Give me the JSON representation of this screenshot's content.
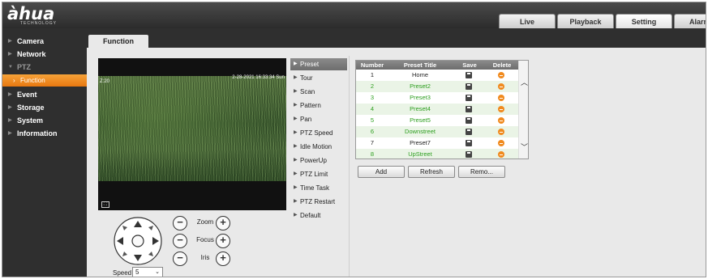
{
  "header": {
    "logo_text": "àhua",
    "logo_sub": "TECHNOLOGY",
    "tabs": [
      {
        "label": "Live"
      },
      {
        "label": "Playback"
      },
      {
        "label": "Setting"
      },
      {
        "label": "Alarm"
      }
    ],
    "active_tab": "Setting"
  },
  "sidebar": {
    "items": [
      {
        "label": "Camera"
      },
      {
        "label": "Network"
      },
      {
        "label": "PTZ"
      },
      {
        "label": "Event"
      },
      {
        "label": "Storage"
      },
      {
        "label": "System"
      },
      {
        "label": "Information"
      }
    ],
    "sub_item": {
      "label": "Function"
    }
  },
  "content": {
    "tab_label": "Function"
  },
  "video": {
    "osd_left": "Z:20",
    "osd_right": "2-28-2021 16:33:34 Sun"
  },
  "ptz": {
    "zoom_label": "Zoom",
    "focus_label": "Focus",
    "iris_label": "Iris",
    "minus": "−",
    "plus": "+",
    "speed_label": "Speed",
    "speed_value": "5"
  },
  "function_menu": {
    "items": [
      {
        "label": "Preset"
      },
      {
        "label": "Tour"
      },
      {
        "label": "Scan"
      },
      {
        "label": "Pattern"
      },
      {
        "label": "Pan"
      },
      {
        "label": "PTZ Speed"
      },
      {
        "label": "Idle Motion"
      },
      {
        "label": "PowerUp"
      },
      {
        "label": "PTZ Limit"
      },
      {
        "label": "Time Task"
      },
      {
        "label": "PTZ Restart"
      },
      {
        "label": "Default"
      }
    ],
    "active": "Preset"
  },
  "preset_table": {
    "headers": {
      "number": "Number",
      "title": "Preset Title",
      "save": "Save",
      "delete": "Delete"
    },
    "rows": [
      {
        "number": "1",
        "title": "Home",
        "set": false
      },
      {
        "number": "2",
        "title": "Preset2",
        "set": true
      },
      {
        "number": "3",
        "title": "Preset3",
        "set": true
      },
      {
        "number": "4",
        "title": "Preset4",
        "set": true
      },
      {
        "number": "5",
        "title": "Preset5",
        "set": true
      },
      {
        "number": "6",
        "title": "Downstreet",
        "set": true
      },
      {
        "number": "7",
        "title": "Preset7",
        "set": false
      },
      {
        "number": "8",
        "title": "UpStreet",
        "set": true
      }
    ]
  },
  "buttons": {
    "add": "Add",
    "refresh": "Refresh",
    "remove": "Remo..."
  },
  "colors": {
    "accent_orange": "#f08a1e",
    "preset_green": "#2c9e1e",
    "chrome_dark": "#2f2f2f"
  }
}
